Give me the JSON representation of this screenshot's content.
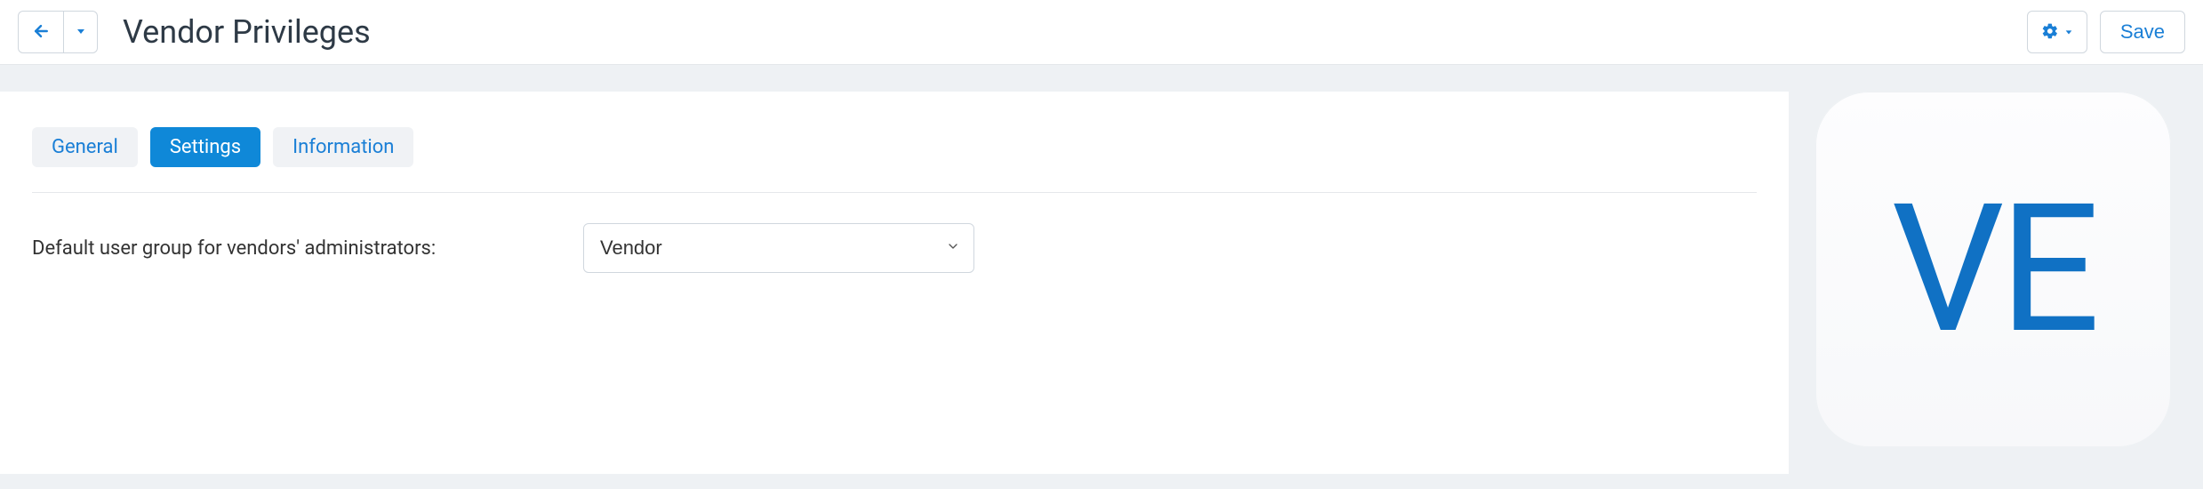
{
  "header": {
    "title": "Vendor Privileges",
    "save_label": "Save"
  },
  "tabs": [
    {
      "label": "General",
      "active": false
    },
    {
      "label": "Settings",
      "active": true
    },
    {
      "label": "Information",
      "active": false
    }
  ],
  "form": {
    "default_group_label": "Default user group for vendors' administrators:",
    "default_group_value": "Vendor"
  },
  "sidebar": {
    "logo_initials": "VE"
  },
  "icons": {
    "arrow_left": "arrow-left-icon",
    "caret_down": "caret-down-icon",
    "gear": "gear-icon",
    "chevron_down": "chevron-down-icon"
  },
  "colors": {
    "accent": "#1a7fd6",
    "tab_active_bg": "#0f88d8",
    "logo_text": "#1071c4"
  }
}
